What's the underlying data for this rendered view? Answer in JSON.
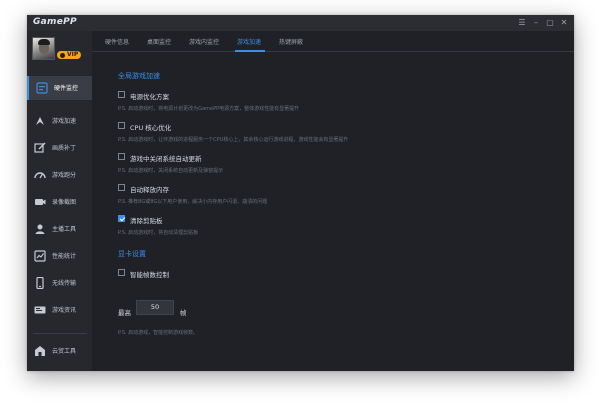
{
  "app": {
    "title": "GamePP",
    "controls": [
      "☰",
      "–",
      "▢",
      "✕"
    ]
  },
  "profile": {
    "badge": "VIP"
  },
  "sidebar": {
    "items": [
      {
        "label": "硬件监控",
        "icon": "hardware-monitor-icon",
        "active": true
      },
      {
        "label": "游戏加速",
        "icon": "game-boost-icon",
        "active": false
      },
      {
        "label": "画质补丁",
        "icon": "graphics-patch-icon",
        "active": false
      },
      {
        "label": "游戏跑分",
        "icon": "benchmark-icon",
        "active": false
      },
      {
        "label": "录像截图",
        "icon": "recording-icon",
        "active": false
      },
      {
        "label": "主播工具",
        "icon": "streamer-tools-icon",
        "active": false
      },
      {
        "label": "性能统计",
        "icon": "performance-stats-icon",
        "active": false
      },
      {
        "label": "无线传输",
        "icon": "wireless-transfer-icon",
        "active": false
      },
      {
        "label": "游戏资讯",
        "icon": "game-news-icon",
        "active": false
      },
      {
        "label": "云贸工具",
        "icon": "cloud-tools-icon",
        "active": false
      }
    ]
  },
  "tabs": [
    {
      "label": "硬件信息",
      "active": false
    },
    {
      "label": "桌面监控",
      "active": false
    },
    {
      "label": "游戏内监控",
      "active": false
    },
    {
      "label": "游戏加速",
      "active": true
    },
    {
      "label": "热键屏蔽",
      "active": false
    }
  ],
  "section_global": {
    "title": "全局游戏加速",
    "options": [
      {
        "title": "电源优化方案",
        "desc": "P.S. 启动游戏时，将电源计划更改为GamePP电源方案，整体游戏性能有显著提升",
        "checked": false
      },
      {
        "title": "CPU 核心优化",
        "desc": "P.S. 启动游戏时，让环游戏的进程服务一个CPU核心上，其余核心运行游戏进程，游戏性能会有显著提升",
        "checked": false
      },
      {
        "title": "游戏中关闭系统自动更新",
        "desc": "P.S. 启动游戏时，关闭系统自动更新及弹窗提示",
        "checked": false
      },
      {
        "title": "自动释放内存",
        "desc": "P.S. 推荐8G或8G以下用户使用，解决小内存用户闪退、崩溃的问题",
        "checked": false
      },
      {
        "title": "清除剪贴板",
        "desc": "P.S. 启动游戏时，将自动清理剪贴板",
        "checked": true
      }
    ]
  },
  "section_gpu": {
    "title": "显卡设置",
    "fps_toggle": {
      "title": "智能帧数控制",
      "checked": false
    },
    "fps_label": "最高",
    "fps_value": "50",
    "fps_unit": "帧",
    "desc": "P.S. 启动游戏，智能控制游戏帧数。"
  },
  "colors": {
    "accent": "#3b8fe6",
    "window_bg": "#1f2126",
    "sidebar_bg": "#26282e",
    "vip": "#f2a516"
  }
}
